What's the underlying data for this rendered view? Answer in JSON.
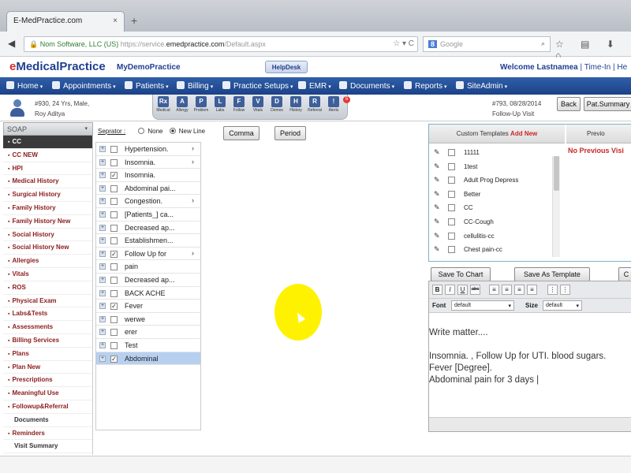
{
  "browser": {
    "tab_title": "E-MedPractice.com",
    "tab_close": "×",
    "new_tab": "+",
    "back": "◀",
    "cert": "Nom Software, LLC (US)",
    "url_prefix": "https://service.",
    "url_host": "emedpractice.com",
    "url_path": "/Default.aspx",
    "reload": "☆ ▾ C",
    "search_engine": "8",
    "search_placeholder": "Google",
    "search_glyph": "⌕",
    "toolbar_glyphs": "☆ ▤ ⬇ ⌂"
  },
  "app": {
    "logo_prefix": "e",
    "logo": "MedicalPractice",
    "practice": "MyDemoPractice",
    "helpdesk": "HelpDesk",
    "welcome": "Welcome Lastnamea",
    "time_in": "| Time-In",
    "help": "| He"
  },
  "menu": [
    {
      "label": "Home"
    },
    {
      "label": "Appointments"
    },
    {
      "label": "Patients"
    },
    {
      "label": "Billing"
    },
    {
      "label": "Practice Setups"
    },
    {
      "label": "EMR"
    },
    {
      "label": "Documents"
    },
    {
      "label": "Reports"
    },
    {
      "label": "SiteAdmin"
    }
  ],
  "menu_caret": "▾",
  "patient": {
    "line1": "#930, 24 Yrs, Male,",
    "line2": "Roy Aditya"
  },
  "tools": [
    {
      "icon": "Rx",
      "label": "Medical"
    },
    {
      "icon": "A",
      "label": "Allergy"
    },
    {
      "icon": "P",
      "label": "Problem"
    },
    {
      "icon": "L",
      "label": "Labs"
    },
    {
      "icon": "F",
      "label": "Follow"
    },
    {
      "icon": "V",
      "label": "Vitals"
    },
    {
      "icon": "D",
      "label": "Demos"
    },
    {
      "icon": "H",
      "label": "History"
    },
    {
      "icon": "R",
      "label": "Referral"
    },
    {
      "icon": "!",
      "label": "Alerts"
    }
  ],
  "alert_count": "5",
  "visit": {
    "line1": "#793, 08/28/2014",
    "line2": "Follow-Up Visit"
  },
  "buttons": {
    "back": "Back",
    "pat_summary": "Pat.Summary",
    "comma": "Comma",
    "period": "Period",
    "save_to_chart": "Save To Chart",
    "save_as_template": "Save As Template",
    "extra": "C"
  },
  "soap": {
    "header": "SOAP",
    "chevron": "▾",
    "items": [
      {
        "label": "CC",
        "state": "active"
      },
      {
        "label": "CC NEW",
        "state": ""
      },
      {
        "label": "HPI",
        "state": ""
      },
      {
        "label": "Medical History",
        "state": ""
      },
      {
        "label": "Surgical History",
        "state": ""
      },
      {
        "label": "Family History",
        "state": ""
      },
      {
        "label": "Family History New",
        "state": ""
      },
      {
        "label": "Social History",
        "state": ""
      },
      {
        "label": "Social History New",
        "state": ""
      },
      {
        "label": "Allergies",
        "state": ""
      },
      {
        "label": "Vitals",
        "state": ""
      },
      {
        "label": "ROS",
        "state": ""
      },
      {
        "label": "Physical Exam",
        "state": ""
      },
      {
        "label": "Labs&Tests",
        "state": ""
      },
      {
        "label": "Assessments",
        "state": ""
      },
      {
        "label": "Billing Services",
        "state": ""
      },
      {
        "label": "Plans",
        "state": ""
      },
      {
        "label": "Plan New",
        "state": ""
      },
      {
        "label": "Prescriptions",
        "state": ""
      },
      {
        "label": "Meaningful Use",
        "state": ""
      },
      {
        "label": "Followup&Referral",
        "state": ""
      },
      {
        "label": "Documents",
        "state": "plain"
      },
      {
        "label": "Reminders",
        "state": ""
      },
      {
        "label": "Visit Summary",
        "state": "plain"
      }
    ]
  },
  "separator": {
    "label": "Seprator :",
    "opt_none": "None",
    "opt_newline": "New Line",
    "selected": "New Line"
  },
  "phrases": [
    {
      "text": "Hypertension.",
      "checked": false,
      "arrow": true,
      "selected": false
    },
    {
      "text": "Insomnia.",
      "checked": false,
      "arrow": true,
      "selected": false
    },
    {
      "text": "Insomnia.",
      "checked": true,
      "arrow": false,
      "selected": false
    },
    {
      "text": "Abdominal pai...",
      "checked": false,
      "arrow": false,
      "selected": false
    },
    {
      "text": "Congestion.",
      "checked": false,
      "arrow": true,
      "selected": false
    },
    {
      "text": "[Patients_] ca...",
      "checked": false,
      "arrow": false,
      "selected": false
    },
    {
      "text": "Decreased ap...",
      "checked": false,
      "arrow": false,
      "selected": false
    },
    {
      "text": "Establishmen...",
      "checked": false,
      "arrow": false,
      "selected": false
    },
    {
      "text": "Follow Up for",
      "checked": true,
      "arrow": true,
      "selected": false
    },
    {
      "text": "pain",
      "checked": false,
      "arrow": false,
      "selected": false
    },
    {
      "text": "Decreased ap...",
      "checked": false,
      "arrow": false,
      "selected": false
    },
    {
      "text": "BACK ACHE",
      "checked": false,
      "arrow": false,
      "selected": false
    },
    {
      "text": "Fever",
      "checked": true,
      "arrow": false,
      "selected": false
    },
    {
      "text": "werwe",
      "checked": false,
      "arrow": false,
      "selected": false
    },
    {
      "text": "erer",
      "checked": false,
      "arrow": false,
      "selected": false
    },
    {
      "text": "Test",
      "checked": false,
      "arrow": false,
      "selected": false
    },
    {
      "text": "Abdominal",
      "checked": true,
      "arrow": false,
      "selected": true
    }
  ],
  "phrase_glyphs": {
    "plus": "+",
    "check": "✓",
    "arrow": "›"
  },
  "templates": {
    "tab_label": "Custom Templates",
    "add_new": "Add New",
    "prev_tab": "Previo",
    "no_previous": "No Previous Visi",
    "pencil": "✎",
    "items": [
      "11111",
      "1test",
      "Adult Prog Depress",
      "Better",
      "CC",
      "CC-Cough",
      "cellulitis-cc",
      "Chest pain-cc"
    ]
  },
  "editor": {
    "tools": [
      "B",
      "I",
      "U",
      "abc",
      "≡",
      "≡",
      "≡",
      "≡",
      "⋮",
      "⋮"
    ],
    "font_label": "Font",
    "font_value": "default",
    "size_label": "Size",
    "size_value": "default",
    "caret": "▾",
    "line1": "Write matter....",
    "line2": "Insomnia. , Follow Up for UTI. blood sugars.",
    "line3": "Fever [Degree].",
    "line4": "Abdominal pain for 3 days |"
  },
  "colors": {
    "menu_bg": "#2f5fa8",
    "soap_red": "#8b1c1c",
    "highlight": "#fff200",
    "selected_row": "#b7d0f0"
  }
}
